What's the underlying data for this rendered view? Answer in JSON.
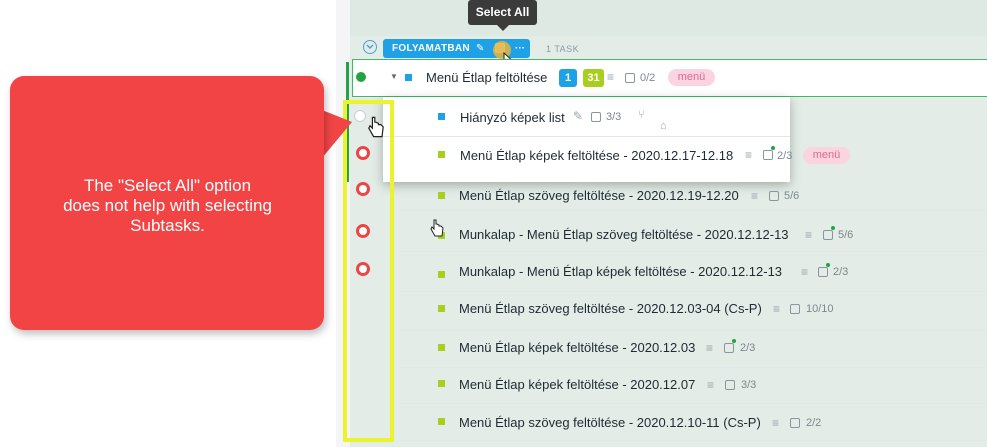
{
  "tooltip": {
    "label": "Select All"
  },
  "group": {
    "status": "FOLYAMATBAN",
    "task_count": "1 TASK"
  },
  "parent_task": {
    "name": "Menü Étlap feltöltése",
    "badge_blue": "1",
    "badge_lime": "31",
    "checklist": "0/2",
    "tag": "menü"
  },
  "popup_rows": [
    {
      "name": "Hiányzó képek list",
      "checklist": "3/3"
    },
    {
      "name": "Menü Étlap képek feltöltése - 2020.12.17-12.18",
      "checklist": "2/3",
      "tag": "menü"
    }
  ],
  "subtasks": [
    {
      "name": "Menü Étlap szöveg feltöltése - 2020.12.19-12.20",
      "checklist": "5/6"
    },
    {
      "name": "Munkalap - Menü Étlap szöveg feltöltése - 2020.12.12-13",
      "checklist": "5/6"
    },
    {
      "name": "Munkalap - Menü Étlap képek feltöltése - 2020.12.12-13",
      "checklist": "2/3"
    },
    {
      "name": "Menü Étlap szöveg feltöltése - 2020.12.03-04 (Cs-P)",
      "checklist": "10/10"
    },
    {
      "name": "Menü Étlap képek feltöltése - 2020.12.03",
      "checklist": "2/3"
    },
    {
      "name": "Menü Étlap képek feltöltése - 2020.12.07",
      "checklist": "3/3"
    },
    {
      "name": "Menü Étlap szöveg feltöltése - 2020.12.10-11 (Cs-P)",
      "checklist": "2/2"
    }
  ],
  "callout": {
    "line1": "The \"Select All\" option",
    "line2": "does not help with selecting",
    "line3": "Subtasks."
  },
  "colors": {
    "status_blue": "#1ea1e6",
    "badge_lime": "#a8cf1e",
    "callout_red": "#f24444",
    "highlight_yellow": "#ecf22b",
    "done_green": "#23a442"
  }
}
